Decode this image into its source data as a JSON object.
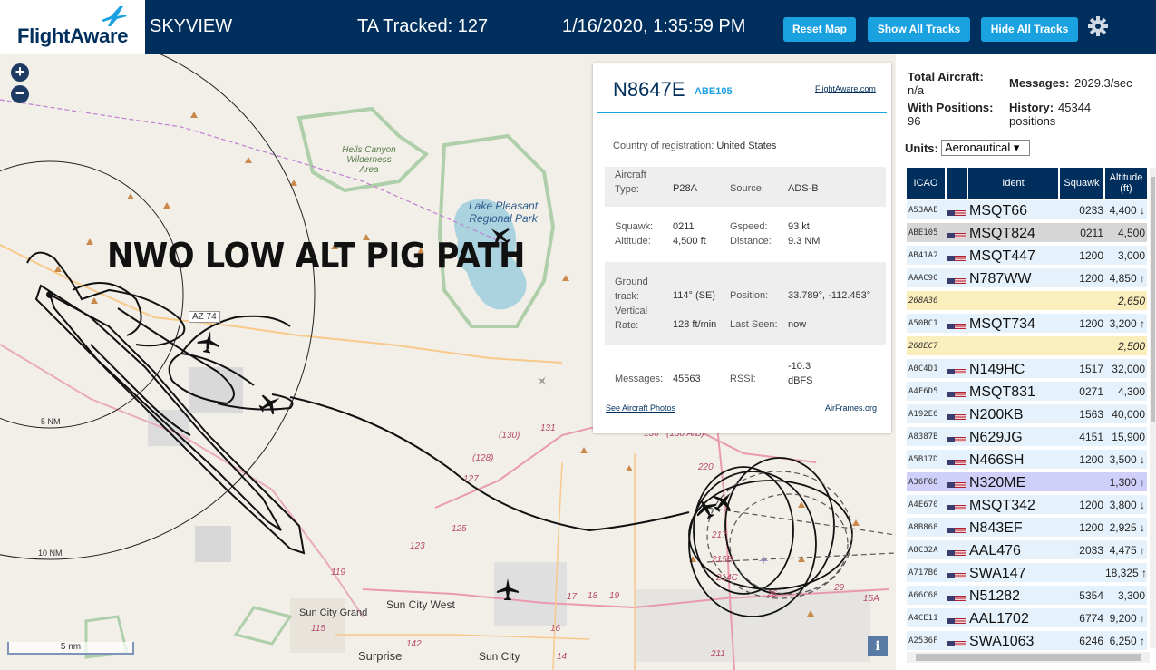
{
  "header": {
    "logo_text": "FlightAware",
    "app_name": "SKYVIEW",
    "tracked": "TA Tracked: 127",
    "datetime": "1/16/2020, 1:35:59 PM",
    "buttons": {
      "reset": "Reset Map",
      "show": "Show All Tracks",
      "hide": "Hide All Tracks"
    }
  },
  "map": {
    "zoom_in": "+",
    "zoom_out": "−",
    "overlay_title": "NWO LOW ALT PIG PATH",
    "labels": {
      "wilderness": "Hells Canyon Wilderness Area",
      "lake": "Lake Pleasant Regional Park",
      "az74": "AZ 74",
      "ring5": "5 NM",
      "ring10": "10 NM",
      "sun_city_west": "Sun City West",
      "sun_city_grand": "Sun City Grand",
      "surprise": "Surprise",
      "sun_city": "Sun City",
      "r119": "119",
      "r115": "115",
      "r123": "123",
      "r125": "125",
      "r127": "127",
      "r128": "(128)",
      "r130": "(130)",
      "r131": "131",
      "r142": "142",
      "r220": "220",
      "r217": "217",
      "r215b": "215B",
      "r214": "214C",
      "r215a": "15A",
      "r29": "29",
      "r26": "26",
      "r18": "18",
      "r19": "19",
      "r17": "17",
      "r16": "16",
      "r14": "14",
      "r211": "211",
      "r136": "136",
      "r138": "(138 A/B)"
    },
    "scale": "5 nm",
    "info": "i"
  },
  "selected_aircraft": {
    "callsign": "N8647E",
    "sub_id": "ABE105",
    "fa_link": "FlightAware.com",
    "country_label": "Country of registration:",
    "country": "United States",
    "type_label": "Aircraft Type:",
    "type": "P28A",
    "source_label": "Source:",
    "source": "ADS-B",
    "squawk_label": "Squawk:",
    "squawk": "0211",
    "gspeed_label": "Gspeed:",
    "gspeed": "93 kt",
    "altitude_label": "Altitude:",
    "altitude": "4,500 ft",
    "distance_label": "Distance:",
    "distance": "9.3 NM",
    "track_label": "Ground track:",
    "track": "114° (SE)",
    "position_label": "Position:",
    "position": "33.789°, -112.453°",
    "vrate_label": "Vertical Rate:",
    "vrate": "128 ft/min",
    "lastseen_label": "Last Seen:",
    "lastseen": "now",
    "messages_label": "Messages:",
    "messages": "45563",
    "rssi_label": "RSSI:",
    "rssi": "-10.3 dBFS",
    "photos_link": "See Aircraft Photos",
    "airframes_link": "AirFrames.org"
  },
  "stats": {
    "total_label": "Total Aircraft:",
    "total": "n/a",
    "messages_label": "Messages:",
    "messages": "2029.3/sec",
    "positions_label": "With Positions:",
    "positions": "96",
    "history_label": "History:",
    "history": "45344 positions",
    "units_label": "Units:",
    "units": "Aeronautical ▾"
  },
  "table": {
    "headers": {
      "icao": "ICAO",
      "ident": "Ident",
      "squawk": "Squawk",
      "altitude": "Altitude (ft)"
    },
    "rows": [
      {
        "icao": "A53AAE",
        "ident": "MSQT66",
        "squawk": "0233",
        "alt": "4,400 ↓",
        "flag": true,
        "style": ""
      },
      {
        "icao": "ABE105",
        "ident": "MSQT824",
        "squawk": "0211",
        "alt": "4,500",
        "flag": true,
        "style": "sel"
      },
      {
        "icao": "AB41A2",
        "ident": "MSQT447",
        "squawk": "1200",
        "alt": "3,000",
        "flag": true,
        "style": ""
      },
      {
        "icao": "AAAC90",
        "ident": "N787WW",
        "squawk": "1200",
        "alt": "4,850 ↑",
        "flag": true,
        "style": ""
      },
      {
        "icao": "268A36",
        "ident": "",
        "squawk": "",
        "alt": "2,650",
        "flag": false,
        "style": "yellow"
      },
      {
        "icao": "A50BC1",
        "ident": "MSQT734",
        "squawk": "1200",
        "alt": "3,200 ↑",
        "flag": true,
        "style": ""
      },
      {
        "icao": "268EC7",
        "ident": "",
        "squawk": "",
        "alt": "2,500",
        "flag": false,
        "style": "yellow"
      },
      {
        "icao": "A0C4D1",
        "ident": "N149HC",
        "squawk": "1517",
        "alt": "32,000",
        "flag": true,
        "style": ""
      },
      {
        "icao": "A4F6D5",
        "ident": "MSQT831",
        "squawk": "0271",
        "alt": "4,300",
        "flag": true,
        "style": ""
      },
      {
        "icao": "A192E6",
        "ident": "N200KB",
        "squawk": "1563",
        "alt": "40,000",
        "flag": true,
        "style": ""
      },
      {
        "icao": "A8387B",
        "ident": "N629JG",
        "squawk": "4151",
        "alt": "15,900",
        "flag": true,
        "style": ""
      },
      {
        "icao": "A5B17D",
        "ident": "N466SH",
        "squawk": "1200",
        "alt": "3,500 ↓",
        "flag": true,
        "style": ""
      },
      {
        "icao": "A36F68",
        "ident": "N320ME",
        "squawk": "",
        "alt": "1,300 ↑",
        "flag": true,
        "style": "hilite"
      },
      {
        "icao": "A4E670",
        "ident": "MSQT342",
        "squawk": "1200",
        "alt": "3,800 ↓",
        "flag": true,
        "style": ""
      },
      {
        "icao": "A8B868",
        "ident": "N843EF",
        "squawk": "1200",
        "alt": "2,925 ↓",
        "flag": true,
        "style": ""
      },
      {
        "icao": "A8C32A",
        "ident": "AAL476",
        "squawk": "2033",
        "alt": "4,475 ↑",
        "flag": true,
        "style": ""
      },
      {
        "icao": "A717B6",
        "ident": "SWA147",
        "squawk": "",
        "alt": "18,325 ↑",
        "flag": true,
        "style": ""
      },
      {
        "icao": "A66C68",
        "ident": "N51282",
        "squawk": "5354",
        "alt": "3,300",
        "flag": true,
        "style": ""
      },
      {
        "icao": "A4CE11",
        "ident": "AAL1702",
        "squawk": "6774",
        "alt": "9,200 ↑",
        "flag": true,
        "style": ""
      },
      {
        "icao": "A2536F",
        "ident": "SWA1063",
        "squawk": "6246",
        "alt": "6,250 ↑",
        "flag": true,
        "style": ""
      }
    ]
  },
  "colors": {
    "navy": "#002f5d",
    "accent": "#1aa1e0"
  }
}
